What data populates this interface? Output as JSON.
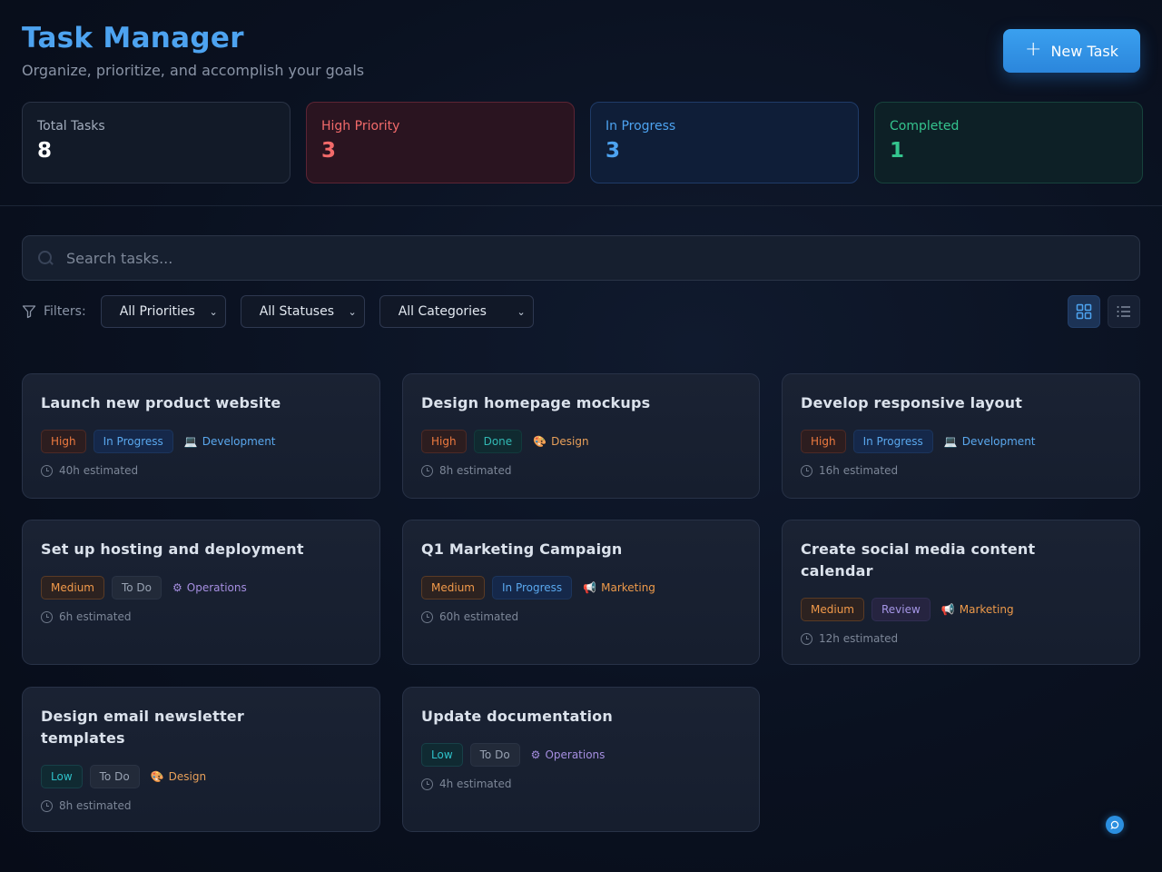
{
  "header": {
    "title": "Task Manager",
    "subtitle": "Organize, prioritize, and accomplish your goals",
    "new_task_label": "New Task"
  },
  "stats": [
    {
      "label": "Total Tasks",
      "value": "8"
    },
    {
      "label": "High Priority",
      "value": "3"
    },
    {
      "label": "In Progress",
      "value": "3"
    },
    {
      "label": "Completed",
      "value": "1"
    }
  ],
  "search": {
    "placeholder": "Search tasks...",
    "value": ""
  },
  "filters": {
    "label": "Filters:",
    "priority": "All Priorities",
    "status": "All Statuses",
    "category": "All Categories"
  },
  "view": {
    "active": "grid"
  },
  "colors": {
    "accent": "#4da3f0",
    "high": "#f26a6a",
    "completed": "#34c48e"
  },
  "tasks": [
    {
      "title": "Launch new product website",
      "priority": "High",
      "status": "In Progress",
      "category": "Development",
      "category_icon": "laptop-icon",
      "estimate": "40h estimated"
    },
    {
      "title": "Design homepage mockups",
      "priority": "High",
      "status": "Done",
      "category": "Design",
      "category_icon": "palette-icon",
      "estimate": "8h estimated"
    },
    {
      "title": "Develop responsive layout",
      "priority": "High",
      "status": "In Progress",
      "category": "Development",
      "category_icon": "laptop-icon",
      "estimate": "16h estimated"
    },
    {
      "title": "Set up hosting and deployment",
      "priority": "Medium",
      "status": "To Do",
      "category": "Operations",
      "category_icon": "gear-icon",
      "estimate": "6h estimated"
    },
    {
      "title": "Q1 Marketing Campaign",
      "priority": "Medium",
      "status": "In Progress",
      "category": "Marketing",
      "category_icon": "megaphone-icon",
      "estimate": "60h estimated"
    },
    {
      "title": "Create social media content calendar",
      "priority": "Medium",
      "status": "Review",
      "category": "Marketing",
      "category_icon": "megaphone-icon",
      "estimate": "12h estimated"
    },
    {
      "title": "Design email newsletter templates",
      "priority": "Low",
      "status": "To Do",
      "category": "Design",
      "category_icon": "palette-icon",
      "estimate": "8h estimated"
    },
    {
      "title": "Update documentation",
      "priority": "Low",
      "status": "To Do",
      "category": "Operations",
      "category_icon": "gear-icon",
      "estimate": "4h estimated"
    }
  ]
}
